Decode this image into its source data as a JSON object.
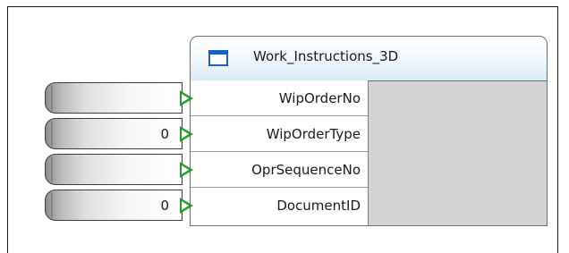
{
  "component": {
    "title": "Work_Instructions_3D",
    "icon": "window-icon"
  },
  "ports": [
    {
      "label": "WipOrderNo",
      "value": ""
    },
    {
      "label": "WipOrderType",
      "value": "0"
    },
    {
      "label": "OprSequenceNo",
      "value": ""
    },
    {
      "label": "DocumentID",
      "value": "0"
    }
  ],
  "colors": {
    "header_gradient_end": "#d8ebf4",
    "icon_blue": "#1f5fc2",
    "connector_green": "#2a9a2a",
    "body_fill": "#d3d3d3"
  }
}
